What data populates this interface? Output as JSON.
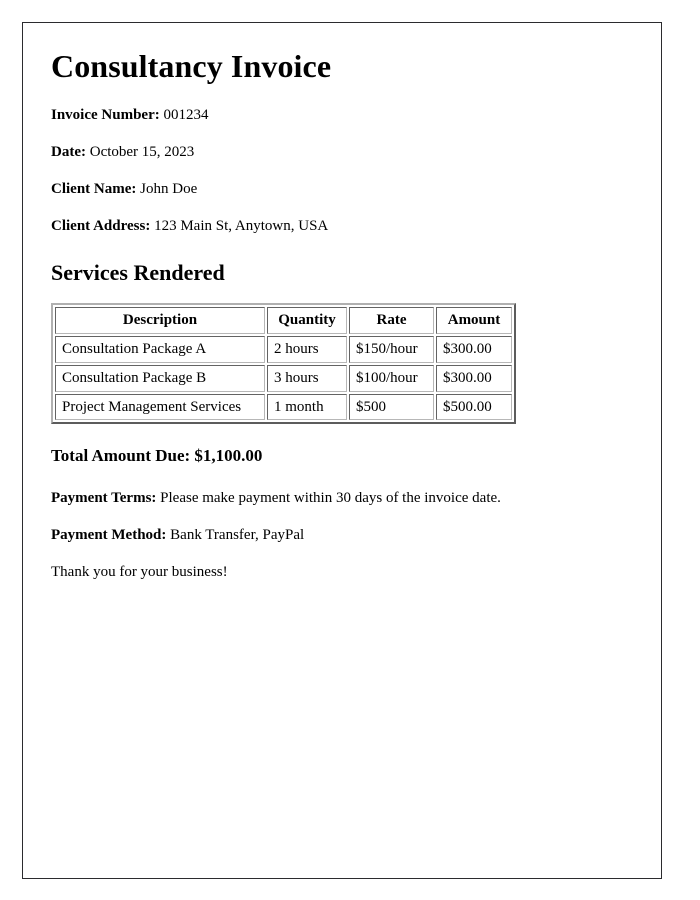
{
  "document": {
    "title": "Consultancy Invoice",
    "meta": [
      {
        "label": "Invoice Number:",
        "value": "001234"
      },
      {
        "label": "Date:",
        "value": "October 15, 2023"
      },
      {
        "label": "Client Name:",
        "value": "John Doe"
      },
      {
        "label": "Client Address:",
        "value": "123 Main St, Anytown, USA"
      }
    ],
    "services_section": {
      "heading": "Services Rendered",
      "table": {
        "columns": [
          "Description",
          "Quantity",
          "Rate",
          "Amount"
        ],
        "rows": [
          [
            "Consultation Package A",
            "2 hours",
            "$150/hour",
            "$300.00"
          ],
          [
            "Consultation Package B",
            "3 hours",
            "$100/hour",
            "$300.00"
          ],
          [
            "Project Management Services",
            "1 month",
            "$500",
            "$500.00"
          ]
        ]
      }
    },
    "total": {
      "label": "Total Amount Due:",
      "value": "$1,100.00",
      "text": "Total Amount Due: $1,100.00"
    },
    "terms": [
      {
        "label": "Payment Terms:",
        "value": "Please make payment within 30 days of the invoice date."
      },
      {
        "label": "Payment Method:",
        "value": "Bank Transfer, PayPal"
      }
    ],
    "closing": "Thank you for your business!",
    "colors": {
      "page_background": "#ffffff",
      "text": "#000000",
      "page_border": "#2b2b2e",
      "table_border": "#b0b0b0"
    }
  }
}
